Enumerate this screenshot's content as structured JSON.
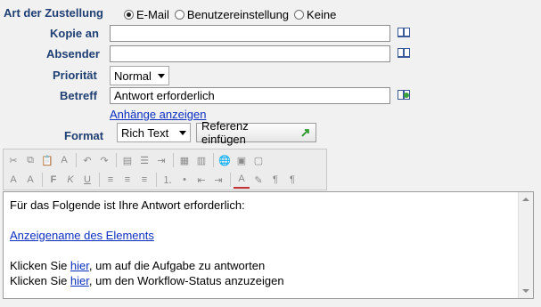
{
  "delivery": {
    "label": "Art der Zustellung",
    "options": [
      "E-Mail",
      "Benutzereinstellung",
      "Keine"
    ],
    "selected": "E-Mail"
  },
  "cc": {
    "label": "Kopie an",
    "value": ""
  },
  "sender": {
    "label": "Absender",
    "value": ""
  },
  "priority": {
    "label": "Priorität",
    "value": "Normal"
  },
  "subject": {
    "label": "Betreff",
    "value": "Antwort erforderlich"
  },
  "attachments_link": "Anhänge anzeigen",
  "format": {
    "label": "Format",
    "value": "Rich Text",
    "reference_button": "Referenz einfügen"
  },
  "editor": {
    "line1": "Für das Folgende ist Ihre Antwort erforderlich:",
    "element_link": "Anzeigename des Elements",
    "line3_prefix": "Klicken Sie ",
    "line3_link": "hier",
    "line3_suffix": ", um auf die Aufgabe zu antworten",
    "line4_prefix": "Klicken Sie ",
    "line4_link": "hier",
    "line4_suffix": ", um den Workflow-Status anzuzeigen"
  },
  "toolbar": {
    "row1": [
      "cut-icon",
      "copy-icon",
      "paste-icon",
      "spellcheck-icon",
      "undo-icon",
      "redo-icon",
      "select-all-icon",
      "bullets-icon",
      "indent-icon",
      "table-icon",
      "table-props-icon",
      "hyperlink-icon",
      "image-icon",
      "special-char-icon"
    ],
    "row2": [
      "format-icon",
      "font-size-icon",
      "bold-icon",
      "italic-icon",
      "underline-icon",
      "align-left-icon",
      "align-center-icon",
      "align-right-icon",
      "numbered-list-icon",
      "bullet-list-icon",
      "outdent-icon",
      "indent-more-icon",
      "font-color-icon",
      "highlight-icon",
      "ltr-icon",
      "rtl-icon"
    ]
  }
}
